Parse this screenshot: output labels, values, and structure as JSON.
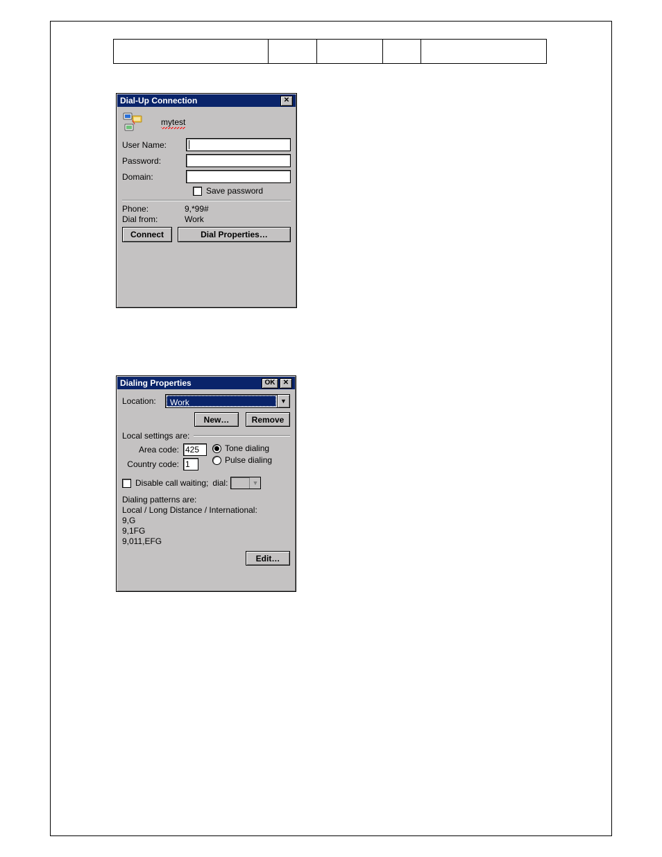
{
  "dialup": {
    "title": "Dial-Up Connection",
    "connection_name": "mytest",
    "labels": {
      "user_name": "User Name:",
      "password": "Password:",
      "domain": "Domain:",
      "save_password": "Save password",
      "phone": "Phone:",
      "dial_from": "Dial from:"
    },
    "values": {
      "user_name": "",
      "password": "",
      "domain": "",
      "save_password_checked": false,
      "phone": "9,*99#",
      "dial_from": "Work"
    },
    "buttons": {
      "connect": "Connect",
      "dial_properties": "Dial Properties…"
    },
    "close_glyph": "✕"
  },
  "dialprops": {
    "title": "Dialing Properties",
    "ok_label": "OK",
    "close_glyph": "✕",
    "location_label": "Location:",
    "location_value": "Work",
    "buttons": {
      "new": "New…",
      "remove": "Remove",
      "edit": "Edit…"
    },
    "local_settings_label": "Local settings are:",
    "area_code_label": "Area code:",
    "area_code_value": "425",
    "country_code_label": "Country code:",
    "country_code_value": "1",
    "tone_label": "Tone dialing",
    "pulse_label": "Pulse dialing",
    "dial_mode": "tone",
    "disable_call_waiting_label": "Disable call waiting;",
    "disable_call_waiting_checked": false,
    "dial_label": "dial:",
    "dial_value": "",
    "patterns_header": "Dialing patterns are:",
    "patterns_sub": "Local / Long Distance / International:",
    "patterns": [
      "9,G",
      "9,1FG",
      "9,011,EFG"
    ],
    "dropdown_glyph": "▼"
  }
}
